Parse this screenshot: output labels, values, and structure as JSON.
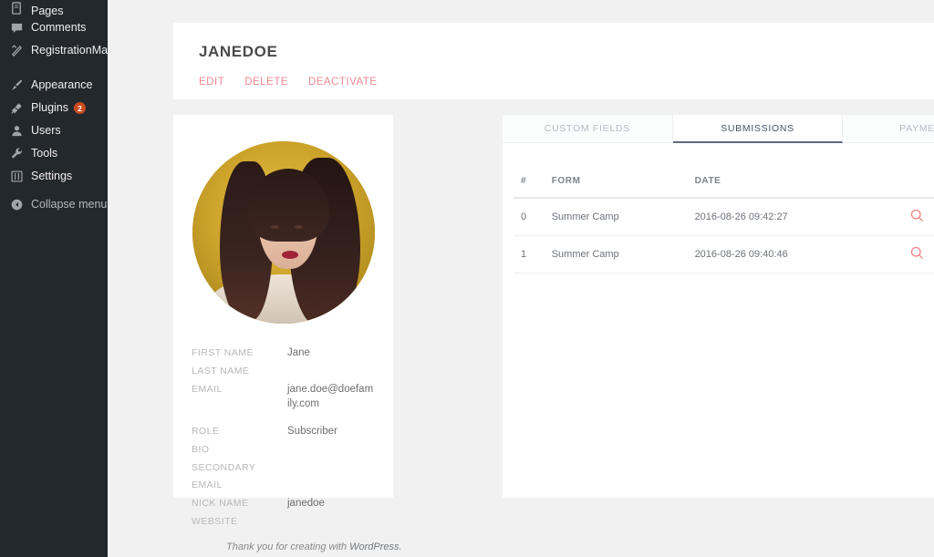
{
  "sidebar": {
    "items": [
      {
        "label": "Pages",
        "icon": "pages-icon",
        "badge": null,
        "dim": false
      },
      {
        "label": "Comments",
        "icon": "comments-icon",
        "badge": null,
        "dim": false
      },
      {
        "label": "RegistrationMagic",
        "icon": "registrationmagic-icon",
        "badge": null,
        "dim": false
      },
      {
        "label": "Appearance",
        "icon": "paintbrush-icon",
        "badge": null,
        "dim": false
      },
      {
        "label": "Plugins",
        "icon": "plug-icon",
        "badge": "2",
        "dim": false
      },
      {
        "label": "Users",
        "icon": "user-icon",
        "badge": null,
        "dim": false
      },
      {
        "label": "Tools",
        "icon": "wrench-icon",
        "badge": null,
        "dim": false
      },
      {
        "label": "Settings",
        "icon": "sliders-icon",
        "badge": null,
        "dim": false
      },
      {
        "label": "Collapse menu",
        "icon": "collapse-icon",
        "badge": null,
        "dim": true
      }
    ]
  },
  "header": {
    "title": "JANEDOE",
    "actions": [
      {
        "label": "EDIT"
      },
      {
        "label": "DELETE"
      },
      {
        "label": "DEACTIVATE"
      }
    ]
  },
  "profile": {
    "avatar_alt": "janedoe avatar",
    "fields": [
      {
        "label": "FIRST NAME",
        "value": "Jane"
      },
      {
        "label": "LAST NAME",
        "value": ""
      },
      {
        "label": "EMAIL",
        "value": "jane.doe@doefamily.com"
      },
      {
        "label": "ROLE",
        "value": "Subscriber"
      },
      {
        "label": "BIO",
        "value": ""
      },
      {
        "label": "SECONDARY EMAIL",
        "value": ""
      },
      {
        "label": "NICK NAME",
        "value": "janedoe"
      },
      {
        "label": "WEBSITE",
        "value": ""
      }
    ]
  },
  "submissions": {
    "tabs": [
      {
        "label": "CUSTOM FIELDS",
        "active": false
      },
      {
        "label": "SUBMISSIONS",
        "active": true
      },
      {
        "label": "PAYMENTS",
        "active": false
      }
    ],
    "columns": [
      "#",
      "FORM",
      "DATE",
      "",
      ""
    ],
    "rows": [
      {
        "num": "0",
        "form": "Summer Camp",
        "date": "2016-08-26 09:42:27",
        "actions": [
          "view-icon",
          "download-icon"
        ]
      },
      {
        "num": "1",
        "form": "Summer Camp",
        "date": "2016-08-26 09:40:46",
        "actions": [
          "view-icon",
          "download-icon"
        ]
      }
    ]
  },
  "footer": {
    "text": "Thank you for creating with",
    "link_label": "WordPress."
  },
  "colors": {
    "sidebar_bg": "#23282d",
    "page_bg": "#f1f1f1",
    "panel_bg": "#ffffff",
    "accent_pink": "#ec8b92",
    "badge_orange": "#ca4a1f",
    "tab_active": "#4a5568"
  }
}
